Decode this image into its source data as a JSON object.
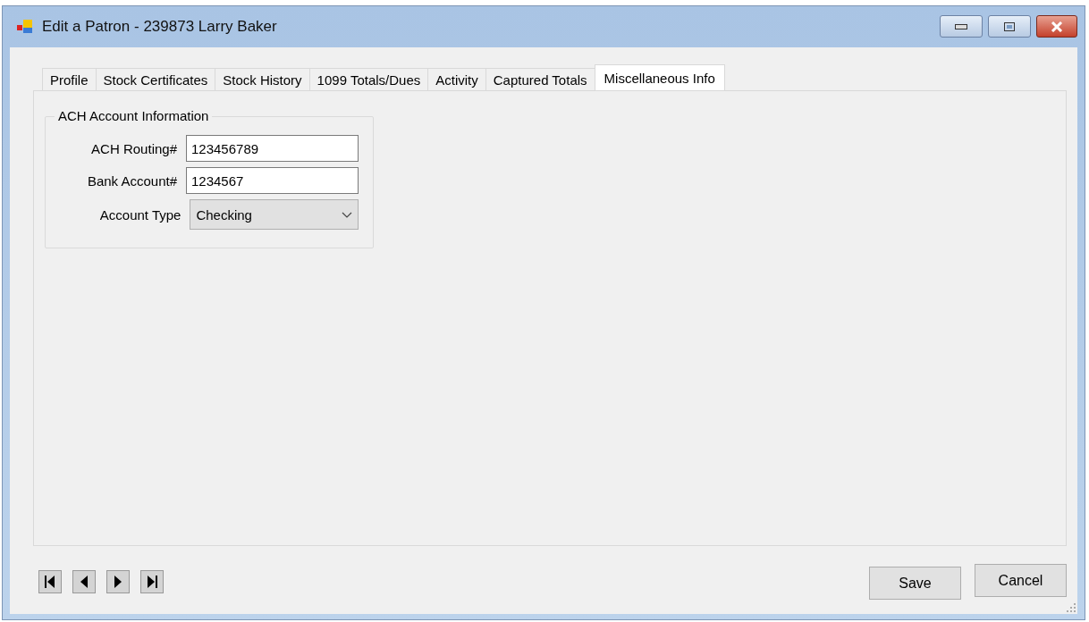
{
  "window": {
    "title": "Edit a Patron - 239873 Larry Baker"
  },
  "tabs": [
    {
      "label": "Profile",
      "selected": false
    },
    {
      "label": "Stock Certificates",
      "selected": false
    },
    {
      "label": "Stock History",
      "selected": false
    },
    {
      "label": "1099 Totals/Dues",
      "selected": false
    },
    {
      "label": "Activity",
      "selected": false
    },
    {
      "label": "Captured Totals",
      "selected": false
    },
    {
      "label": "Miscellaneous Info",
      "selected": true
    }
  ],
  "group": {
    "title": "ACH Account Information",
    "fields": [
      {
        "kind": "text",
        "label": "ACH Routing#",
        "value": "123456789"
      },
      {
        "kind": "text",
        "label": "Bank Account#",
        "value": "1234567"
      },
      {
        "kind": "select",
        "label": "Account Type",
        "value": "Checking"
      }
    ]
  },
  "nav_buttons": [
    {
      "kind": "first"
    },
    {
      "kind": "previous"
    },
    {
      "kind": "next"
    },
    {
      "kind": "last"
    }
  ],
  "buttons": [
    "Save",
    "Cancel"
  ]
}
